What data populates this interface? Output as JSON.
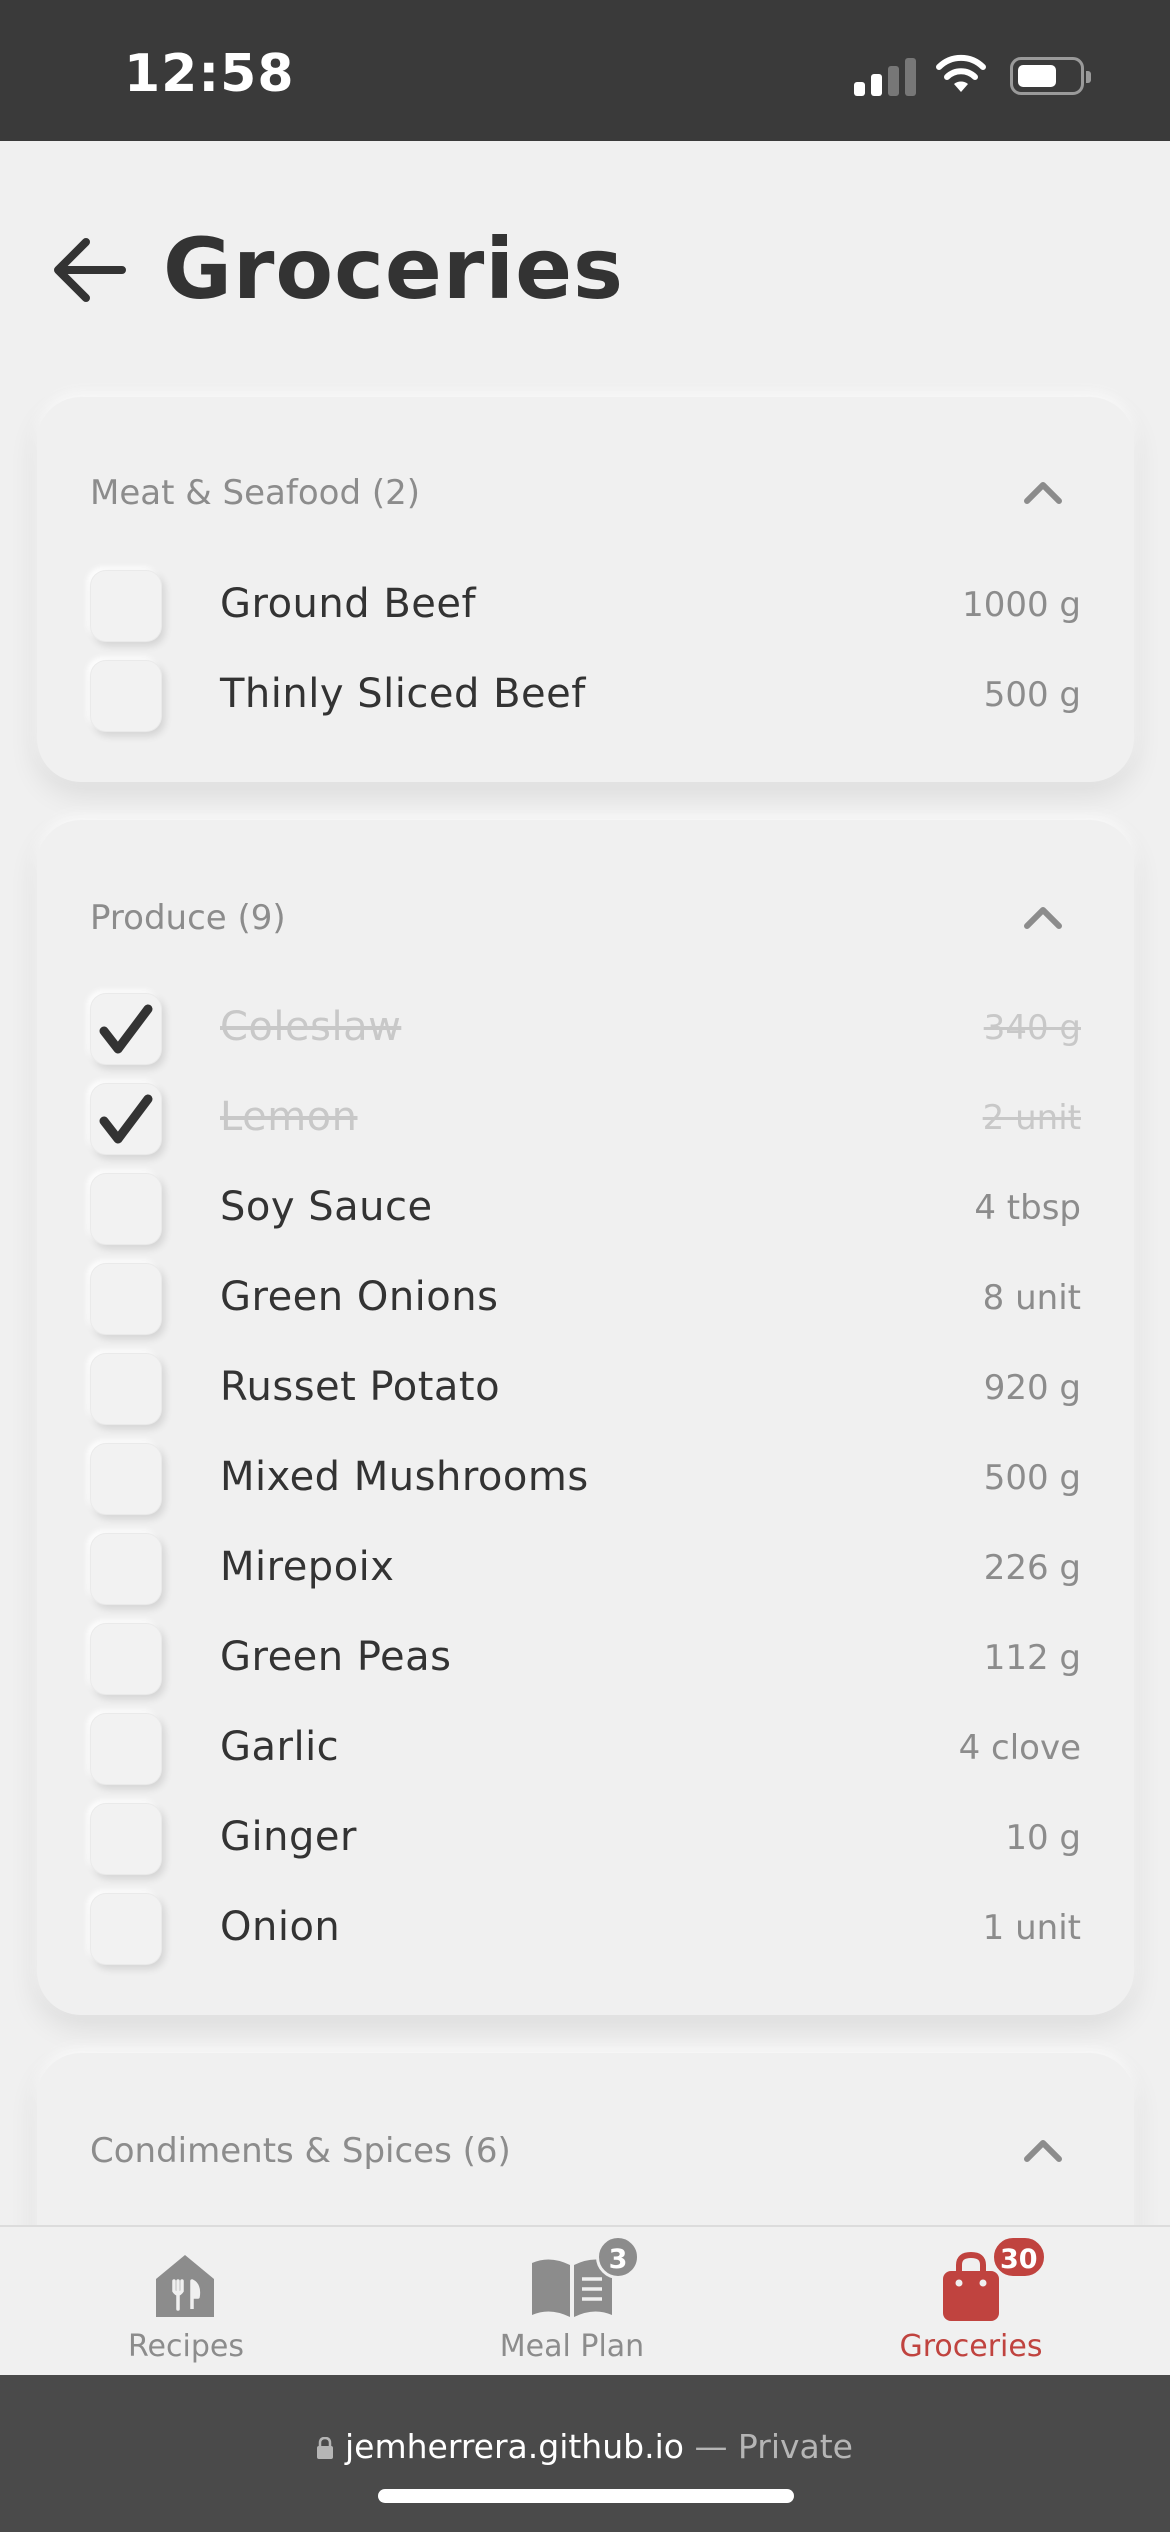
{
  "status_bar": {
    "time": "12:58"
  },
  "header": {
    "title": "Groceries"
  },
  "sections": [
    {
      "title": "Meat & Seafood (2)",
      "items": [
        {
          "name": "Ground Beef",
          "qty": "1000 g",
          "checked": false
        },
        {
          "name": "Thinly Sliced Beef",
          "qty": "500 g",
          "checked": false
        }
      ]
    },
    {
      "title": "Produce (9)",
      "items": [
        {
          "name": "Coleslaw",
          "qty": "340 g",
          "checked": true
        },
        {
          "name": "Lemon",
          "qty": "2 unit",
          "checked": true
        },
        {
          "name": "Soy Sauce",
          "qty": "4 tbsp",
          "checked": false
        },
        {
          "name": "Green Onions",
          "qty": "8 unit",
          "checked": false
        },
        {
          "name": "Russet Potato",
          "qty": "920 g",
          "checked": false
        },
        {
          "name": "Mixed Mushrooms",
          "qty": "500 g",
          "checked": false
        },
        {
          "name": "Mirepoix",
          "qty": "226 g",
          "checked": false
        },
        {
          "name": "Green Peas",
          "qty": "112 g",
          "checked": false
        },
        {
          "name": "Garlic",
          "qty": "4 clove",
          "checked": false
        },
        {
          "name": "Ginger",
          "qty": "10 g",
          "checked": false
        },
        {
          "name": "Onion",
          "qty": "1 unit",
          "checked": false
        }
      ]
    },
    {
      "title": "Condiments & Spices (6)",
      "items": []
    }
  ],
  "tabs": [
    {
      "label": "Recipes",
      "icon": "recipes-icon",
      "badge": ""
    },
    {
      "label": "Meal Plan",
      "icon": "meal-plan-book-icon",
      "badge": "3"
    },
    {
      "label": "Groceries",
      "icon": "grocery-bag-icon",
      "badge": "30",
      "active": true
    }
  ],
  "browser": {
    "domain": "jemherrera.github.io",
    "mode": "— Private"
  },
  "colors": {
    "accent": "#c0433f",
    "badge_gray": "#8c8c8c",
    "background": "#f0f0f0"
  }
}
